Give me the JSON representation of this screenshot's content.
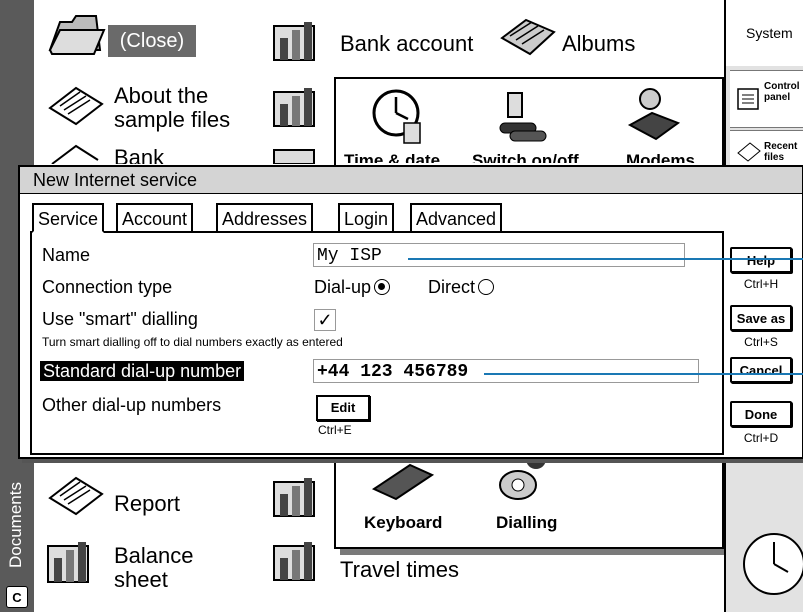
{
  "sidebar": {
    "label": "Documents",
    "corner_button": "C"
  },
  "desktop": {
    "close_label": "(Close)",
    "items": [
      {
        "label": "About the\nsample files"
      },
      {
        "label": "Bank"
      },
      {
        "label": "Report"
      },
      {
        "label": "Balance\nsheet"
      }
    ],
    "right_col": [
      {
        "label": "Bank account"
      },
      {
        "label": "Albums"
      },
      {
        "label": "Travel times"
      }
    ]
  },
  "control_panel": {
    "items": [
      {
        "label": "Time & date",
        "icon": "clock-icon"
      },
      {
        "label": "Switch on/off",
        "icon": "batteries-icon"
      },
      {
        "label": "Modems",
        "icon": "modem-icon"
      },
      {
        "label": "Keyboard",
        "icon": "keyboard-icon"
      },
      {
        "label": "Dialling",
        "icon": "phone-icon"
      }
    ]
  },
  "right_panel": {
    "title": "System",
    "items": [
      {
        "label": "Control\npanel"
      },
      {
        "label": "Recent\nfiles"
      }
    ]
  },
  "dialog": {
    "title": "New Internet service",
    "tabs": [
      "Service",
      "Account",
      "Addresses",
      "Login",
      "Advanced"
    ],
    "active_tab": "Service",
    "fields": {
      "name_label": "Name",
      "name_value": "My ISP",
      "conn_label": "Connection type",
      "dialup_label": "Dial-up",
      "direct_label": "Direct",
      "smart_label": "Use \"smart\" dialling",
      "smart_hint": "Turn smart dialling off to dial numbers exactly as entered",
      "std_label": "Standard dial-up number",
      "std_value": "+44 123 456789",
      "other_label": "Other dial-up numbers",
      "edit_label": "Edit",
      "edit_shortcut": "Ctrl+E"
    },
    "buttons": [
      {
        "label": "Help",
        "shortcut": "Ctrl+H"
      },
      {
        "label": "Save as",
        "shortcut": "Ctrl+S"
      },
      {
        "label": "Cancel",
        "shortcut": ""
      },
      {
        "label": "Done",
        "shortcut": "Ctrl+D"
      }
    ]
  },
  "colors": {
    "callout": "#1a78b4",
    "panel_shadow": "#7a7a7a"
  }
}
